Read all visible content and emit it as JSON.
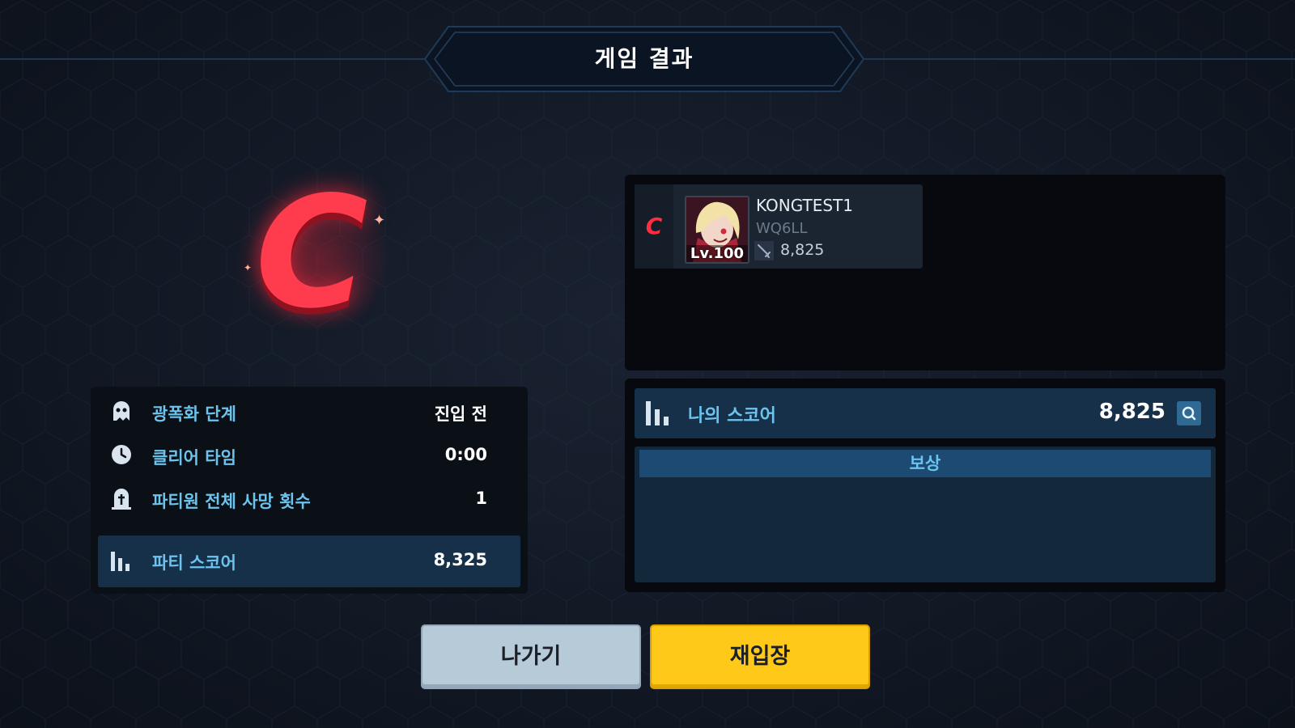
{
  "title": "게임 결과",
  "grade": "C",
  "party_stats": [
    {
      "icon": "ghost-icon",
      "label": "광폭화 단계",
      "value": "진입 전"
    },
    {
      "icon": "clock-icon",
      "label": "클리어 타임",
      "value": "0:00"
    },
    {
      "icon": "tombstone-icon",
      "label": "파티원 전체 사망 횟수",
      "value": "1"
    }
  ],
  "party_score": {
    "icon": "bar-chart-icon",
    "label": "파티 스코어",
    "value": "8,325"
  },
  "player": {
    "grade": "C",
    "level": "Lv.100",
    "name": "KONGTEST1",
    "id": "WQ6LL",
    "score": "8,825"
  },
  "my_score": {
    "icon": "bar-chart-icon",
    "label": "나의 스코어",
    "value": "8,825"
  },
  "reward": {
    "header": "보상"
  },
  "buttons": {
    "exit": "나가기",
    "reenter": "재입장"
  },
  "colors": {
    "accent_text": "#6cc4ee",
    "grade_red": "#ff3b4e",
    "panel_blue": "#16304a",
    "reenter_yellow": "#ffc91a",
    "exit_gray": "#b7cad8"
  }
}
